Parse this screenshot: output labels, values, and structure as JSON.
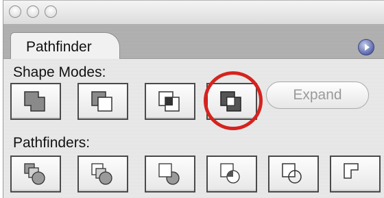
{
  "panel": {
    "tab_label": "Pathfinder"
  },
  "shape_modes": {
    "label": "Shape Modes:",
    "buttons": [
      "add-to-shape-area",
      "subtract-from-shape-area",
      "intersect-shape-areas",
      "exclude-overlapping-shape-areas"
    ],
    "expand_label": "Expand"
  },
  "pathfinders": {
    "label": "Pathfinders:",
    "buttons": [
      "divide",
      "trim",
      "merge",
      "crop",
      "outline",
      "minus-back"
    ]
  },
  "highlight_color": "#d5231f"
}
